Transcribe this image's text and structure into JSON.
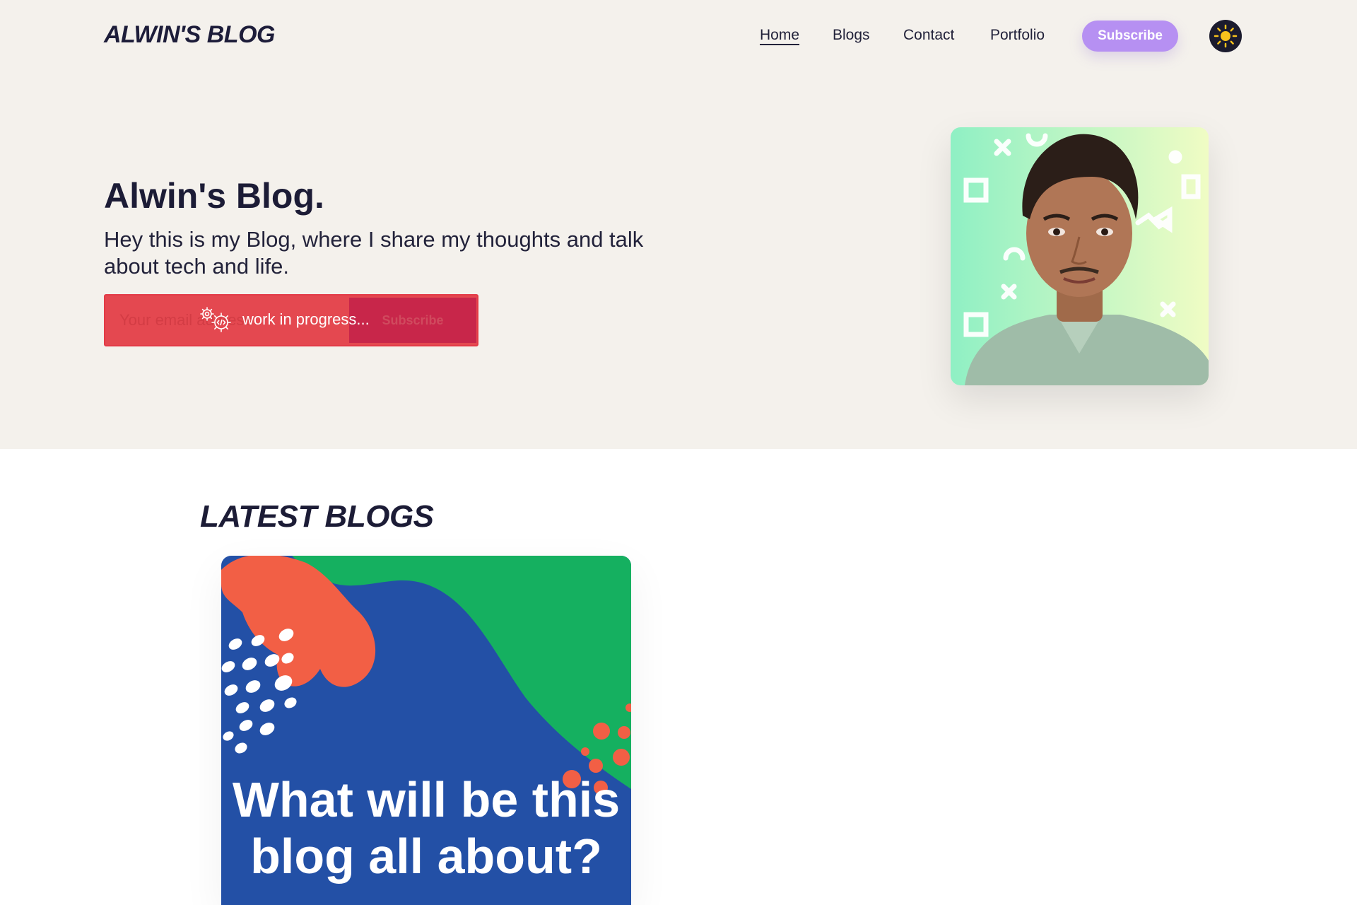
{
  "nav": {
    "logo": "ALWIN'S BLOG",
    "links": [
      {
        "label": "Home"
      },
      {
        "label": "Blogs"
      },
      {
        "label": "Contact"
      },
      {
        "label": "Portfolio"
      }
    ],
    "subscribe_label": "Subscribe",
    "theme_icon": "sun-icon"
  },
  "hero": {
    "title": "Alwin's Blog.",
    "subtitle": "Hey this is my Blog, where I share my thoughts and talk about tech and life.",
    "email_placeholder": "Your email address",
    "form_button_label": "Subscribe",
    "wip_text": "work in progress..."
  },
  "latest": {
    "heading": "LATEST BLOGS",
    "cards": [
      {
        "title": "What will be this blog all about?"
      }
    ]
  },
  "colors": {
    "background_band": "#f4f1ec",
    "accent_purple": "#b690f2",
    "form_red": "#e44850",
    "card_blue": "#2350a6",
    "card_green": "#15b060",
    "card_orange": "#f25f45"
  }
}
